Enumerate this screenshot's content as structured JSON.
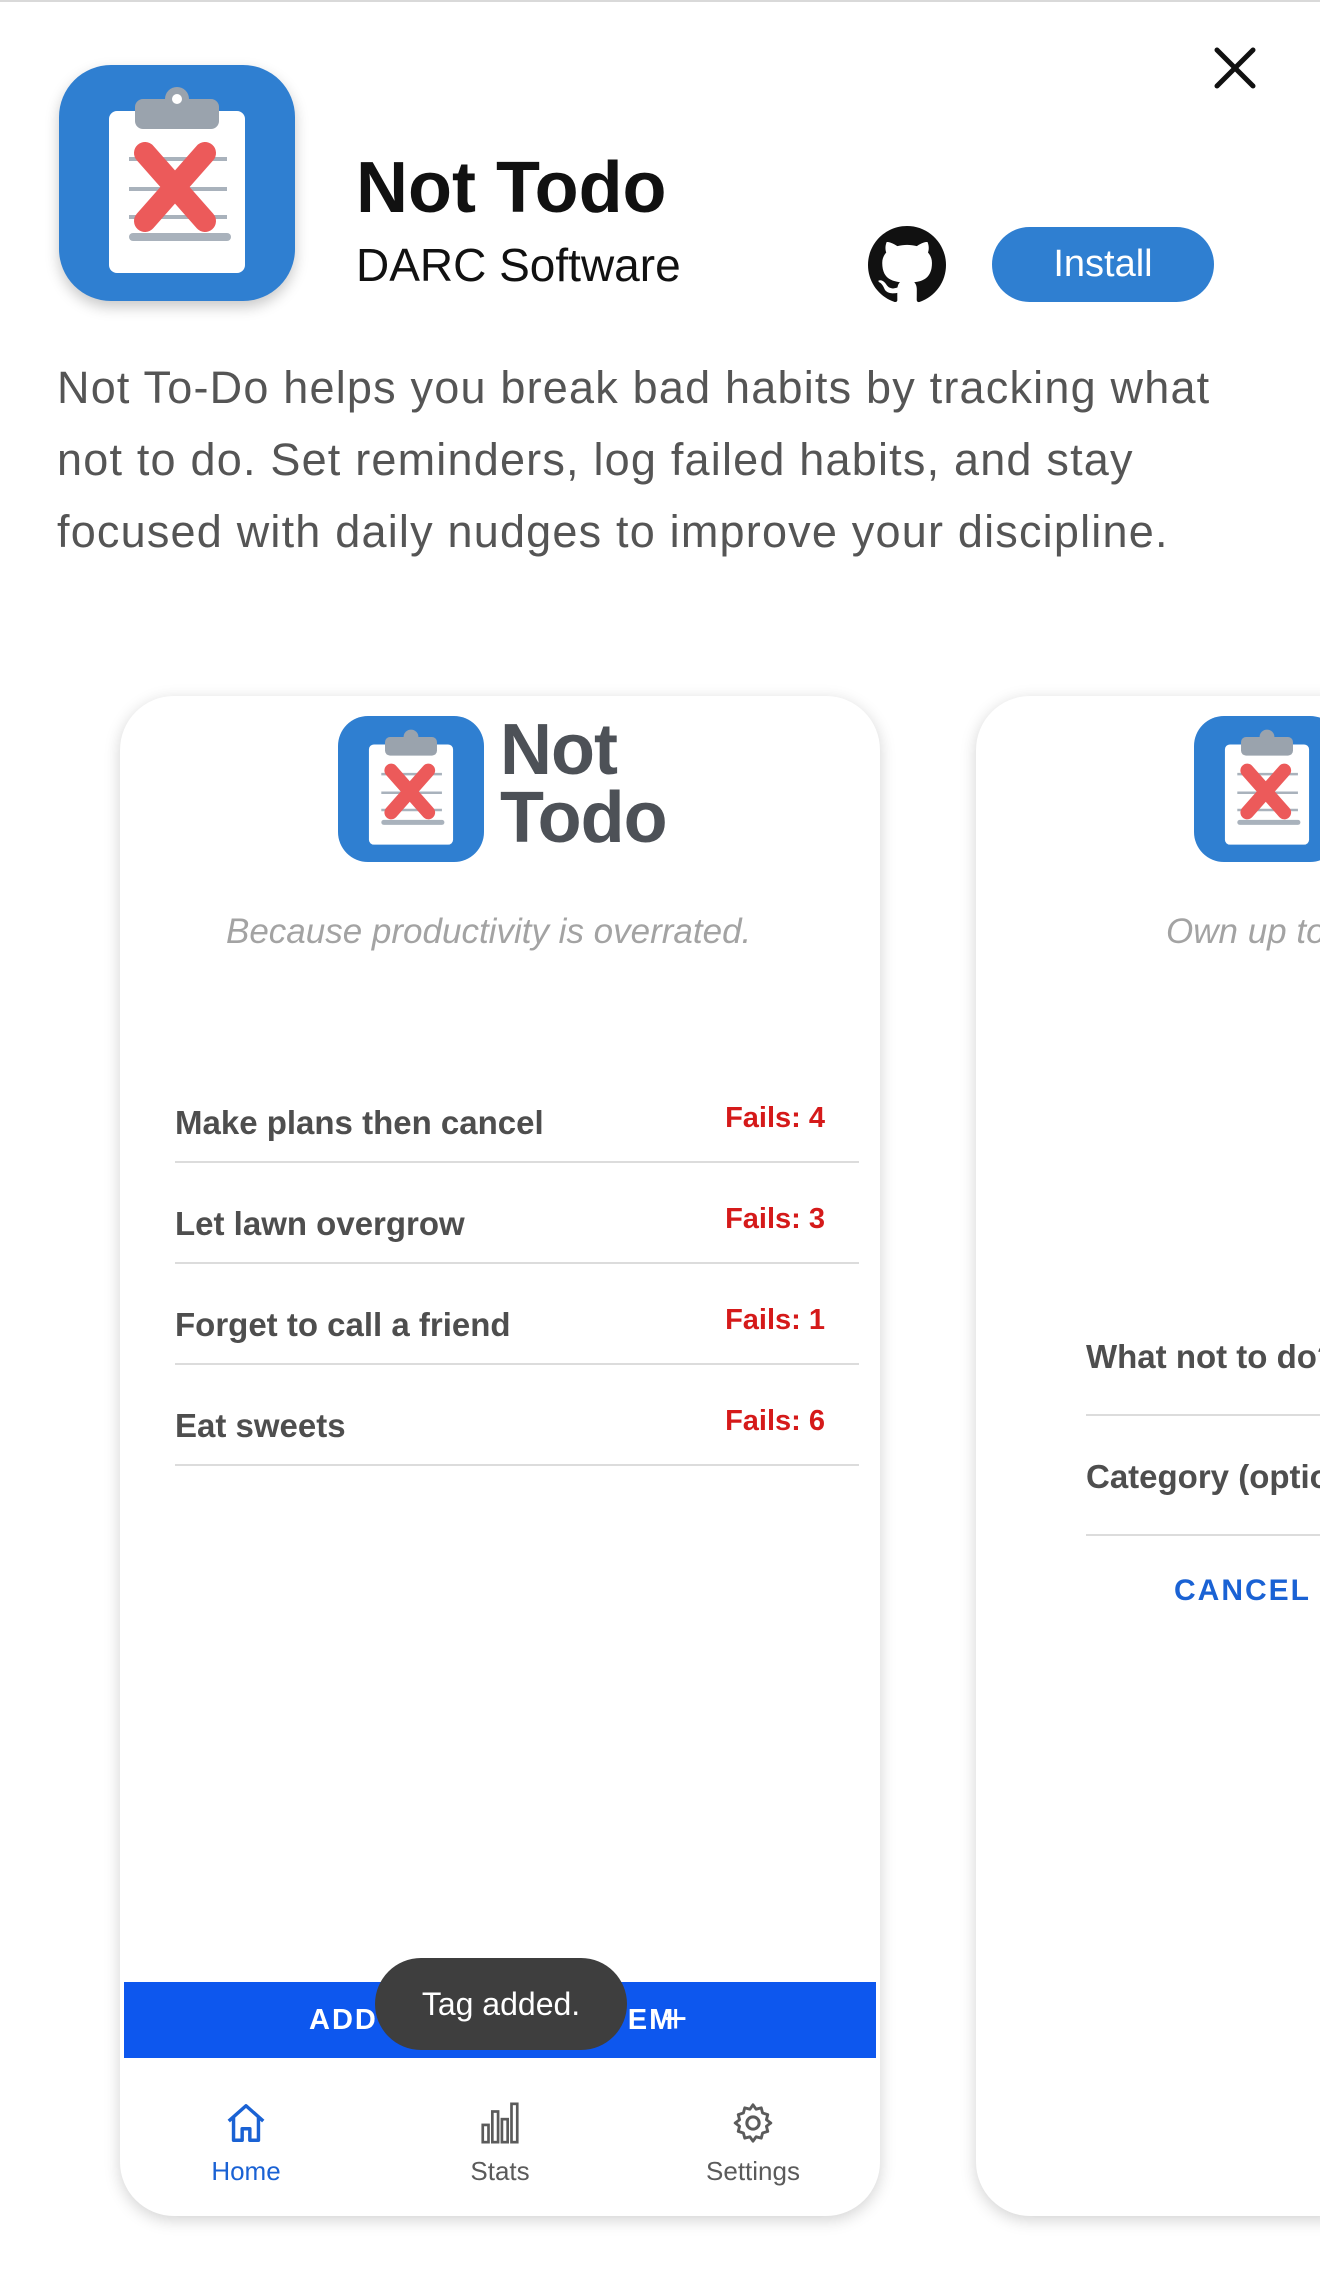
{
  "app": {
    "title": "Not Todo",
    "publisher": "DARC Software",
    "install_label": "Install",
    "description": "Not To-Do helps you break bad habits by tracking what not to do. Set reminders, log failed habits, and stay focused with daily nudges to improve your discipline."
  },
  "colors": {
    "brand_blue": "#2f7fd1",
    "add_bar_blue": "#0d57ee",
    "fails_red": "#d51a1a",
    "active_nav": "#1a62d4"
  },
  "screenshot1": {
    "logo_line1": "Not",
    "logo_line2": "Todo",
    "tagline": "Because productivity is overrated.",
    "items": [
      {
        "label": "Make plans then cancel",
        "fails": "Fails: 4"
      },
      {
        "label": "Let lawn overgrow",
        "fails": "Fails: 3"
      },
      {
        "label": "Forget to call a friend",
        "fails": "Fails: 1"
      },
      {
        "label": "Eat sweets",
        "fails": "Fails: 6"
      }
    ],
    "add_button_label": "ADD \"NOT TODO\" ITEM",
    "add_button_icon": "+",
    "toast": "Tag added.",
    "nav": [
      {
        "label": "Home",
        "icon": "home-icon",
        "active": true
      },
      {
        "label": "Stats",
        "icon": "bar-chart-icon",
        "active": false
      },
      {
        "label": "Settings",
        "icon": "gear-icon",
        "active": false
      }
    ]
  },
  "screenshot2": {
    "tagline": "Own up to",
    "field1_label": "What not to do?",
    "field2_label": "Category (optio",
    "cancel_label": "CANCEL"
  }
}
